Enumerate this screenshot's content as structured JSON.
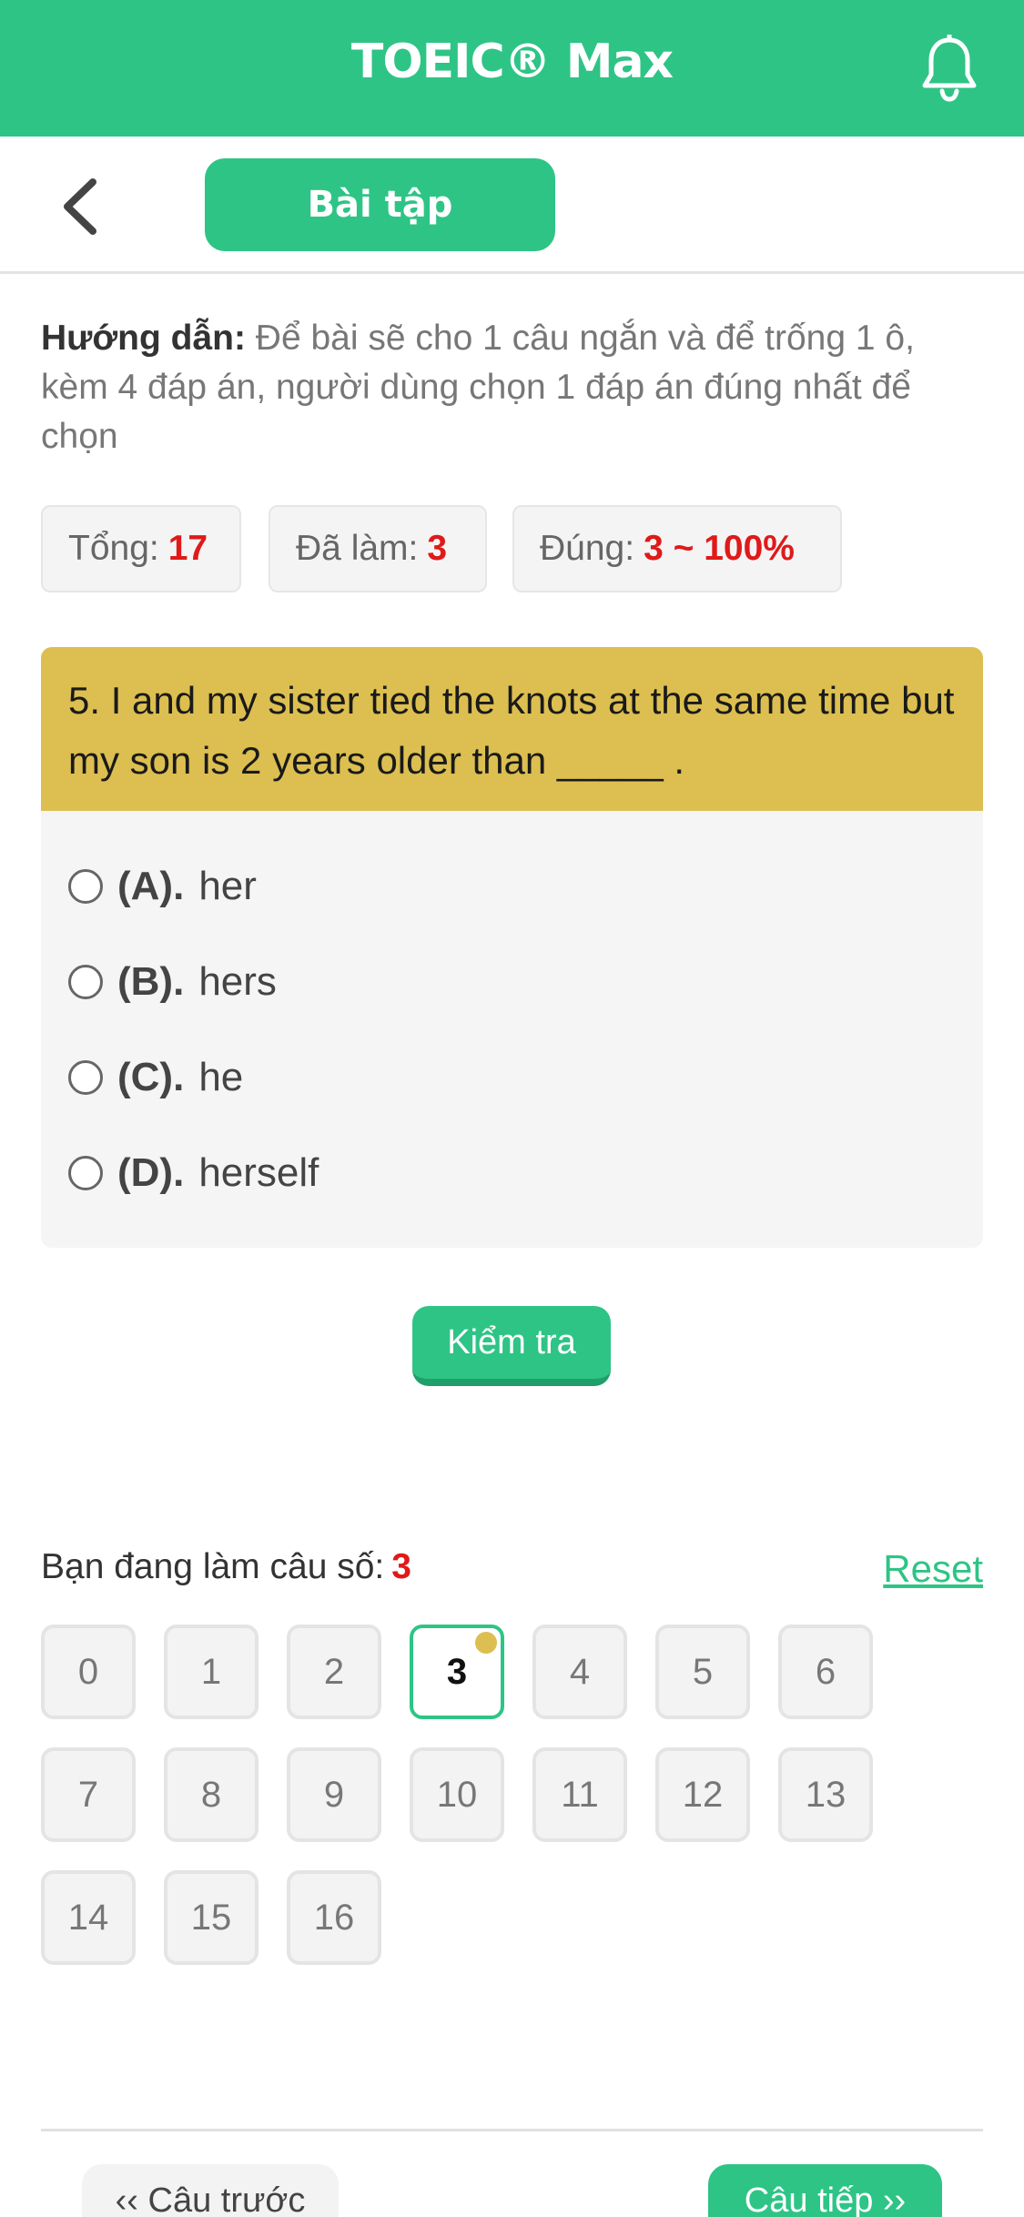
{
  "header": {
    "title": "TOEIC® Max",
    "bell_icon": "bell-icon",
    "color": "#2ec486"
  },
  "toolbar": {
    "back_icon": "chevron-left-icon",
    "tab_label": "Bài tập"
  },
  "instructions": {
    "label": "Hướng dẫn:",
    "text": "Để bài sẽ cho 1 câu ngắn và để trống 1 ô, kèm 4 đáp án, người dùng chọn 1 đáp án đúng nhất để chọn"
  },
  "stats": {
    "total_label": "Tổng:",
    "total_value": "17",
    "done_label": "Đã làm:",
    "done_value": "3",
    "correct_label": "Đúng:",
    "correct_value": "3 ~ 100%"
  },
  "question": {
    "text": "5. I and my sister tied the knots at the same time but my son is 2 years older than _____ .",
    "options": [
      {
        "label": "(A).",
        "text": "her"
      },
      {
        "label": "(B).",
        "text": "hers"
      },
      {
        "label": "(C).",
        "text": "he"
      },
      {
        "label": "(D).",
        "text": "herself"
      }
    ]
  },
  "check_button": "Kiểm tra",
  "navigator": {
    "current_label": "Bạn đang làm câu số:",
    "current_value": "3",
    "reset_label": "Reset",
    "numbers": [
      "0",
      "1",
      "2",
      "3",
      "4",
      "5",
      "6",
      "7",
      "8",
      "9",
      "10",
      "11",
      "12",
      "13",
      "14",
      "15",
      "16"
    ],
    "active": "3"
  },
  "footer": {
    "prev_label": "‹‹ Câu trước",
    "next_label": "Câu tiếp ››"
  }
}
